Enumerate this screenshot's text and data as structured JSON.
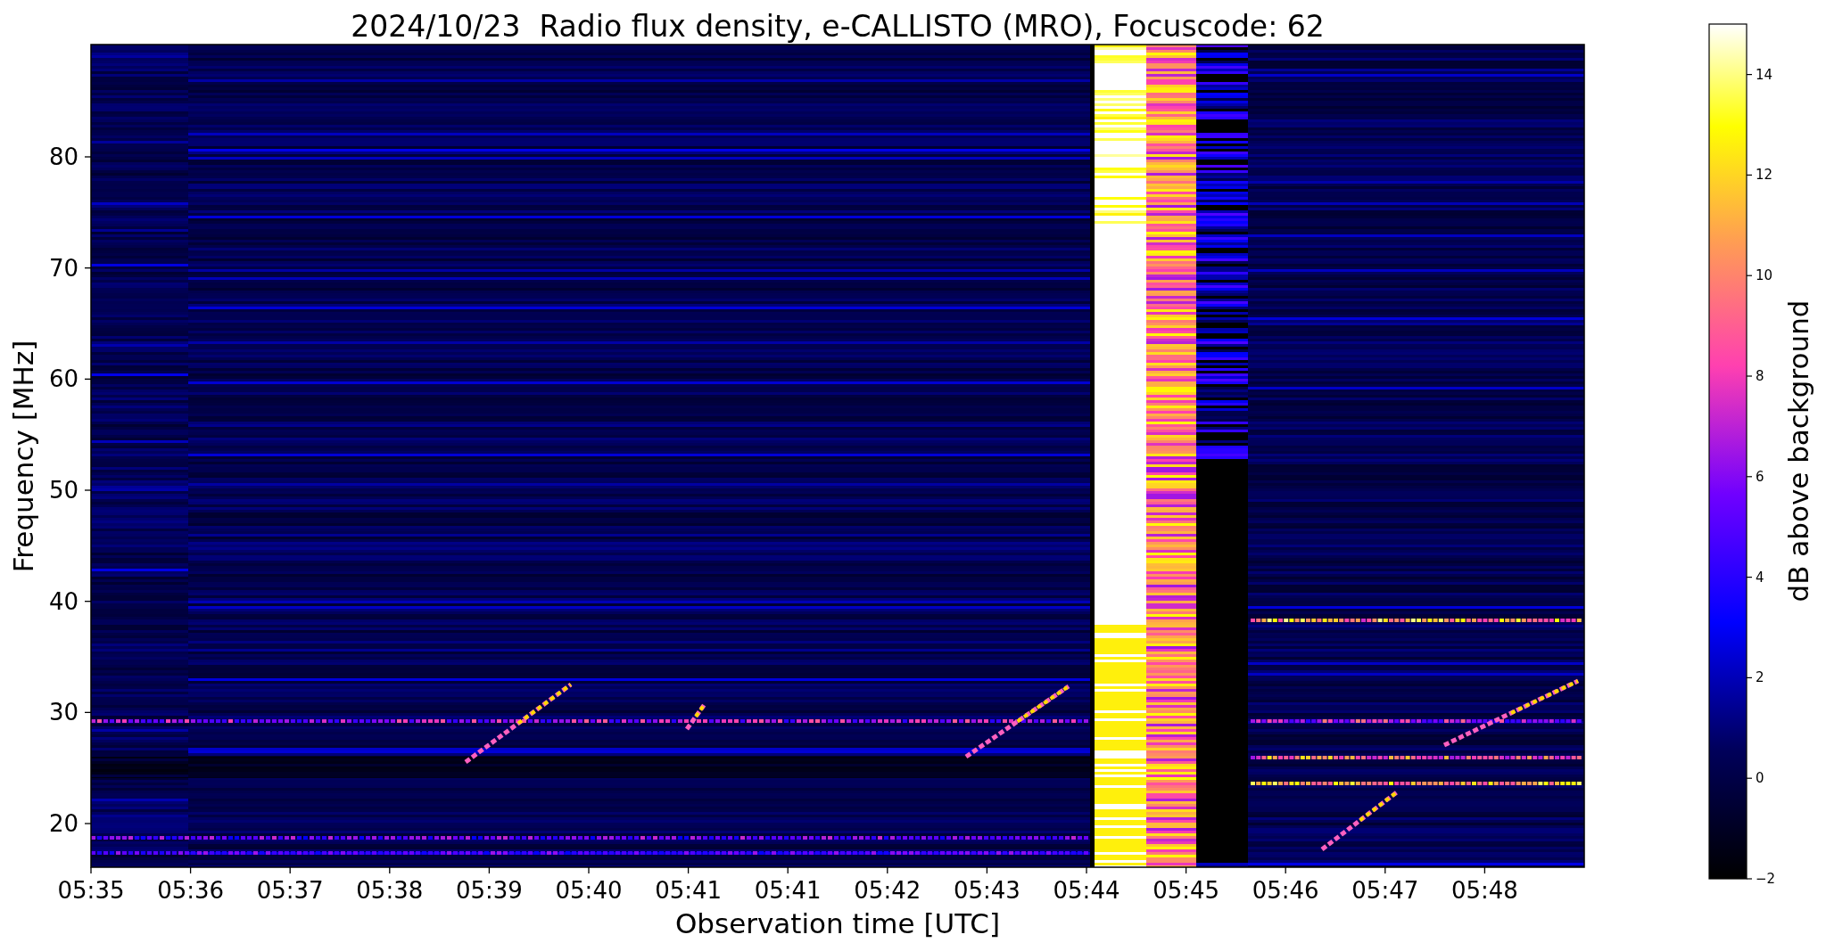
{
  "title": "2024/10/23  Radio flux density, e-CALLISTO (MRO), Focuscode: 62",
  "plot": {
    "xlabel": "Observation time [UTC]",
    "ylabel": "Frequency [MHz]",
    "xticks": [
      "05:35",
      "05:36",
      "05:37",
      "05:38",
      "05:39",
      "05:40",
      "05:41",
      "05:41",
      "05:42",
      "05:43",
      "05:44",
      "05:45",
      "05:46",
      "05:47",
      "05:48"
    ],
    "yticks": [
      "80",
      "70",
      "60",
      "50",
      "40",
      "30",
      "20"
    ]
  },
  "colorbar": {
    "label": "dB above background",
    "ticks": [
      "14",
      "12",
      "10",
      "8",
      "6",
      "4",
      "2",
      "0",
      "−2"
    ]
  }
}
